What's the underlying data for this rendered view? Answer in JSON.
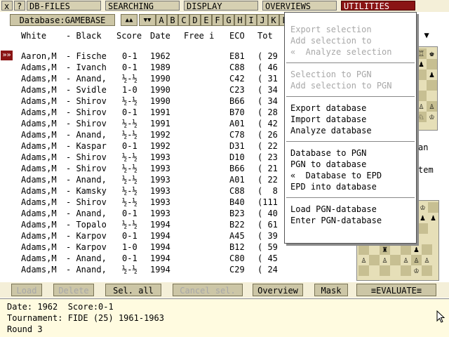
{
  "menubar": {
    "items": [
      {
        "label": "x"
      },
      {
        "label": "?"
      },
      {
        "label": "DB-FILES"
      },
      {
        "label": "SEARCHING"
      },
      {
        "label": "DISPLAY"
      },
      {
        "label": "OVERVIEWS"
      },
      {
        "label": "UTILITIES"
      }
    ]
  },
  "toolbar": {
    "database_label": "Database:GAMEBASE",
    "up_label": "▲▲",
    "down_label": "▼▼",
    "letters": [
      "A",
      "B",
      "C",
      "D",
      "E",
      "F",
      "G",
      "H",
      "I",
      "J",
      "K",
      "L"
    ],
    "right_arrows": "▲ ▼"
  },
  "columns": {
    "white": "White",
    "black": "- Black",
    "score": "Score",
    "date": "Date",
    "free": "Free i",
    "eco": "ECO",
    "tot": "Tot"
  },
  "marker": "»»",
  "games": [
    {
      "white": "Aaron,M",
      "black": "- Fische",
      "score": "0-1",
      "date": "1962",
      "eco": "E81",
      "tot": "( 29"
    },
    {
      "white": "Adams,M",
      "black": "- Ivanch",
      "score": "0-1",
      "date": "1989",
      "eco": "C88",
      "tot": "( 46"
    },
    {
      "white": "Adams,M",
      "black": "- Anand,",
      "score": "½-½",
      "date": "1990",
      "eco": "C42",
      "tot": "( 31"
    },
    {
      "white": "Adams,M",
      "black": "- Svidle",
      "score": "1-0",
      "date": "1990",
      "eco": "C23",
      "tot": "( 34"
    },
    {
      "white": "Adams,M",
      "black": "- Shirov",
      "score": "½-½",
      "date": "1990",
      "eco": "B66",
      "tot": "( 34"
    },
    {
      "white": "Adams,M",
      "black": "- Shirov",
      "score": "0-1",
      "date": "1991",
      "eco": "B70",
      "tot": "( 28"
    },
    {
      "white": "Adams,M",
      "black": "- Shirov",
      "score": "½-½",
      "date": "1991",
      "eco": "A01",
      "tot": "( 42"
    },
    {
      "white": "Adams,M",
      "black": "- Anand,",
      "score": "½-½",
      "date": "1992",
      "eco": "C78",
      "tot": "( 26"
    },
    {
      "white": "Adams,M",
      "black": "- Kaspar",
      "score": "0-1",
      "date": "1992",
      "eco": "D31",
      "tot": "( 22"
    },
    {
      "white": "Adams,M",
      "black": "- Shirov",
      "score": "½-½",
      "date": "1993",
      "eco": "D10",
      "tot": "( 23"
    },
    {
      "white": "Adams,M",
      "black": "- Shirov",
      "score": "½-½",
      "date": "1993",
      "eco": "B66",
      "tot": "( 21"
    },
    {
      "white": "Adams,M",
      "black": "- Anand,",
      "score": "½-½",
      "date": "1993",
      "eco": "A01",
      "tot": "( 22"
    },
    {
      "white": "Adams,M",
      "black": "- Kamsky",
      "score": "½-½",
      "date": "1993",
      "eco": "C88",
      "tot": "(  8"
    },
    {
      "white": "Adams,M",
      "black": "- Shirov",
      "score": "½-½",
      "date": "1993",
      "eco": "B40",
      "tot": "(111"
    },
    {
      "white": "Adams,M",
      "black": "- Anand,",
      "score": "0-1",
      "date": "1993",
      "eco": "B23",
      "tot": "( 40"
    },
    {
      "white": "Adams,M",
      "black": "- Topalo",
      "score": "½-½",
      "date": "1994",
      "eco": "B22",
      "tot": "( 61"
    },
    {
      "white": "Adams,M",
      "black": "- Karpov",
      "score": "0-1",
      "date": "1994",
      "eco": "A45",
      "tot": "( 39"
    },
    {
      "white": "Adams,M",
      "black": "- Karpov",
      "score": "1-0",
      "date": "1994",
      "eco": "B12",
      "tot": "( 59"
    },
    {
      "white": "Adams,M",
      "black": "- Anand,",
      "score": "0-1",
      "date": "1994",
      "eco": "C80",
      "tot": "( 45"
    },
    {
      "white": "Adams,M",
      "black": "- Anand,",
      "score": "½-½",
      "date": "1994",
      "eco": "C29",
      "tot": "( 24"
    }
  ],
  "right_fragments": {
    "an": "an",
    "tem": "tem"
  },
  "utilities_menu": {
    "groups": [
      {
        "items": [
          {
            "label": "Export selection",
            "enabled": false
          },
          {
            "label": "Add selection to",
            "enabled": false
          },
          {
            "label": "«  Analyze selection",
            "enabled": false
          }
        ]
      },
      {
        "items": [
          {
            "label": "Selection to PGN",
            "enabled": false
          },
          {
            "label": "Add selection to PGN",
            "enabled": false
          }
        ]
      },
      {
        "items": [
          {
            "label": "Export database",
            "enabled": true
          },
          {
            "label": "Import database",
            "enabled": true
          },
          {
            "label": "Analyze database",
            "enabled": true
          }
        ]
      },
      {
        "items": [
          {
            "label": "Database to PGN",
            "enabled": true
          },
          {
            "label": "PGN to database",
            "enabled": true
          },
          {
            "label": "«  Database to EPD",
            "enabled": true
          },
          {
            "label": "EPD into database",
            "enabled": true
          }
        ]
      },
      {
        "items": [
          {
            "label": "Load PGN-database",
            "enabled": true
          },
          {
            "label": "Enter PGN-database",
            "enabled": true
          }
        ]
      }
    ]
  },
  "bottom_buttons": [
    {
      "label": "Load",
      "enabled": false
    },
    {
      "label": "Delete",
      "enabled": false
    },
    {
      "label": "Sel. all",
      "enabled": true
    },
    {
      "label": "Cancel sel.",
      "enabled": false
    },
    {
      "label": "Overview",
      "enabled": true
    },
    {
      "label": "Mask",
      "enabled": true
    },
    {
      "label": "≡EVALUATE≡",
      "enabled": true
    }
  ],
  "info": {
    "line1": "Date: 1962  Score:0-1",
    "line2": "Tournament: FIDE (25) 1961-1963",
    "line3": "Round 3"
  },
  "colors": {
    "accent": "#8a1414",
    "menubar_bg": "#f4efd8",
    "button_bg": "#ccc6a6",
    "info_bg": "#fffbe0"
  }
}
